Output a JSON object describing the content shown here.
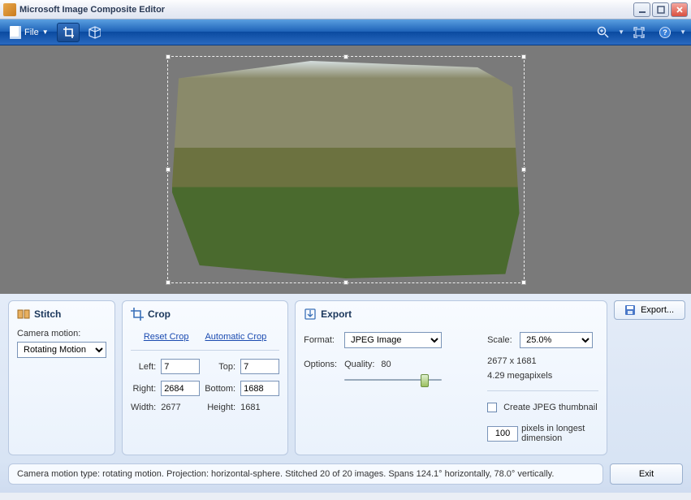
{
  "window": {
    "title": "Microsoft Image Composite Editor"
  },
  "toolbar": {
    "file_label": "File"
  },
  "stitch": {
    "title": "Stitch",
    "camera_motion_label": "Camera motion:",
    "camera_motion_value": "Rotating Motion"
  },
  "crop": {
    "title": "Crop",
    "reset_link": "Reset Crop",
    "auto_link": "Automatic Crop",
    "left_label": "Left:",
    "left_value": "7",
    "top_label": "Top:",
    "top_value": "7",
    "right_label": "Right:",
    "right_value": "2684",
    "bottom_label": "Bottom:",
    "bottom_value": "1688",
    "width_label": "Width:",
    "width_value": "2677",
    "height_label": "Height:",
    "height_value": "1681"
  },
  "export": {
    "title": "Export",
    "format_label": "Format:",
    "format_value": "JPEG Image",
    "options_label": "Options:",
    "quality_label": "Quality:",
    "quality_value": "80",
    "scale_label": "Scale:",
    "scale_value": "25.0%",
    "dims_text": "2677 x 1681",
    "mp_text": "4.29 megapixels",
    "thumb_label": "Create JPEG thumbnail",
    "thumb_px": "100",
    "thumb_caption": "pixels in longest dimension",
    "export_button": "Export..."
  },
  "status": {
    "text": "Camera motion type: rotating motion. Projection: horizontal-sphere. Stitched 20 of 20 images. Spans 124.1° horizontally, 78.0° vertically.",
    "exit_label": "Exit"
  }
}
